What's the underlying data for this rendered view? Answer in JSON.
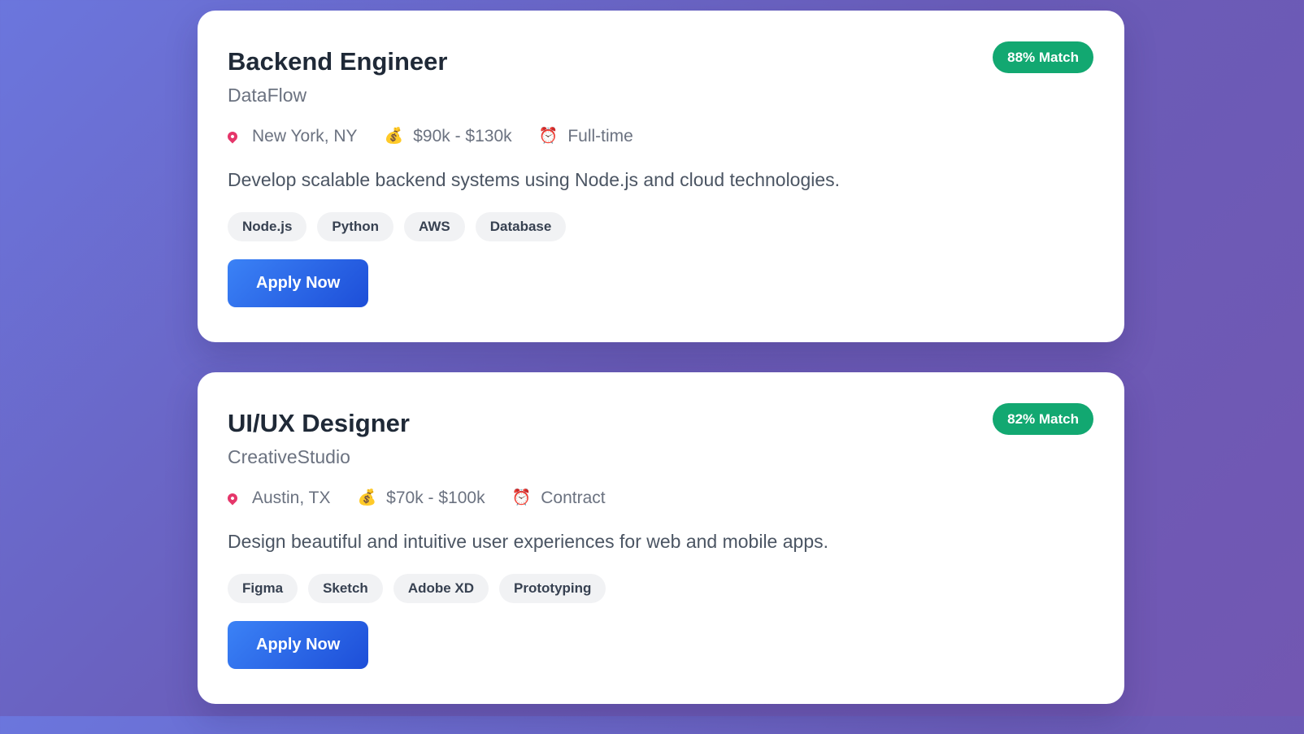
{
  "jobs": [
    {
      "title": "Backend Engineer",
      "company": "DataFlow",
      "match": "88% Match",
      "location": "New York, NY",
      "salary": "$90k - $130k",
      "type": "Full-time",
      "description": "Develop scalable backend systems using Node.js and cloud technologies.",
      "tags": [
        "Node.js",
        "Python",
        "AWS",
        "Database"
      ],
      "apply_label": "Apply Now"
    },
    {
      "title": "UI/UX Designer",
      "company": "CreativeStudio",
      "match": "82% Match",
      "location": "Austin, TX",
      "salary": "$70k - $100k",
      "type": "Contract",
      "description": "Design beautiful and intuitive user experiences for web and mobile apps.",
      "tags": [
        "Figma",
        "Sketch",
        "Adobe XD",
        "Prototyping"
      ],
      "apply_label": "Apply Now"
    }
  ],
  "icons": {
    "location": "map-pin-icon",
    "salary": "money-bag-icon",
    "type": "alarm-clock-icon"
  },
  "colors": {
    "match_badge": "#12a871",
    "apply_button": "#2563eb"
  }
}
